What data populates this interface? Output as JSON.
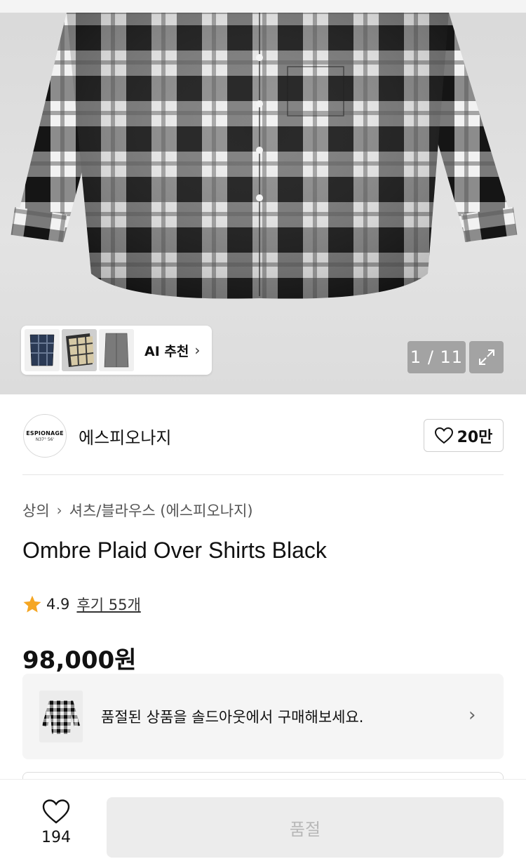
{
  "gallery": {
    "ai_label": "AI 추천",
    "pager": "1 / 11",
    "icons": {
      "expand": "expand-icon",
      "chevron": "chevron-right-icon"
    }
  },
  "brand": {
    "logo_line1": "ESPIONAGE",
    "logo_line2": "N37° 56'",
    "name": "에스피오나지",
    "like_count": "20만"
  },
  "breadcrumb": {
    "items": [
      "상의",
      "셔츠/블라우스 (에스피오나지)"
    ]
  },
  "product": {
    "title": "Ombre Plaid Over Shirts Black",
    "rating": "4.9",
    "reviews": "후기 55개",
    "price": "98,000원"
  },
  "soldout_banner": {
    "text": "품절된 상품을 솔드아웃에서 구매해보세요."
  },
  "bottom_bar": {
    "wish_count": "194",
    "cta_label": "품절"
  },
  "colors": {
    "accent_star": "#f5a623",
    "button_disabled_bg": "#ececec",
    "button_disabled_text": "#b8b8b8"
  }
}
